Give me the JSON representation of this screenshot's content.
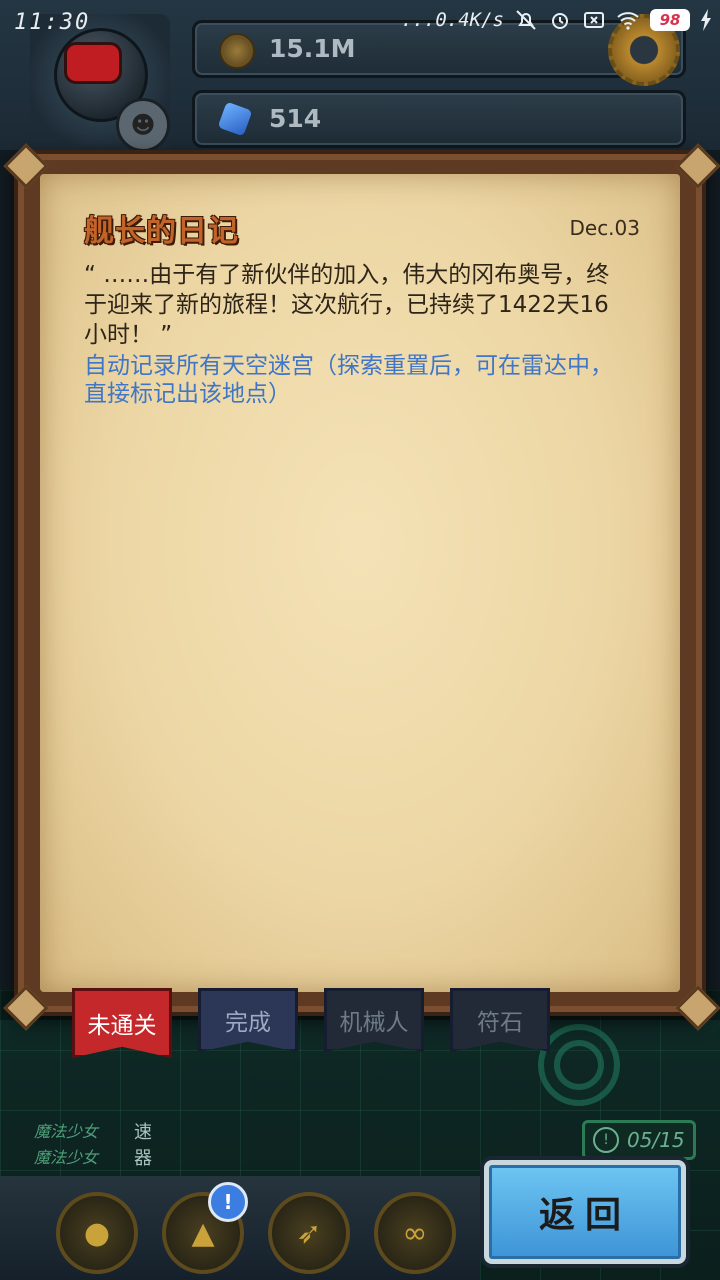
{
  "status_bar": {
    "time": "11:30",
    "net_speed": "...0.4K/s",
    "battery": "98"
  },
  "resources": {
    "gold": "15.1M",
    "gems": "514"
  },
  "dialog": {
    "title": "舰长的日记",
    "date": "Dec.03",
    "body": "“ ……由于有了新伙伴的加入，伟大的冈布奥号，终于迎来了新的旅程！这次航行，已持续了1422天16小时！ ”",
    "note": "自动记录所有天空迷宫（探索重置后，可在雷达中，直接标记出该地点）"
  },
  "tabs": [
    {
      "label": "未通关",
      "active": true
    },
    {
      "label": "完成",
      "active": false
    },
    {
      "label": "机械人",
      "active": false
    },
    {
      "label": "符石",
      "active": false
    }
  ],
  "ticker": {
    "line1": "魔法少女",
    "line2": "魔法少女",
    "side1": "速",
    "side2": "器"
  },
  "counter": "05/15",
  "back_button": "返回",
  "nav_icons": [
    "slime-icon",
    "ship-icon",
    "rocket-icon",
    "pretzel-icon"
  ],
  "colors": {
    "title": "#c2642a",
    "note": "#3f76c8",
    "back_button": "#4fa8e4",
    "active_tab": "#c4282a"
  }
}
